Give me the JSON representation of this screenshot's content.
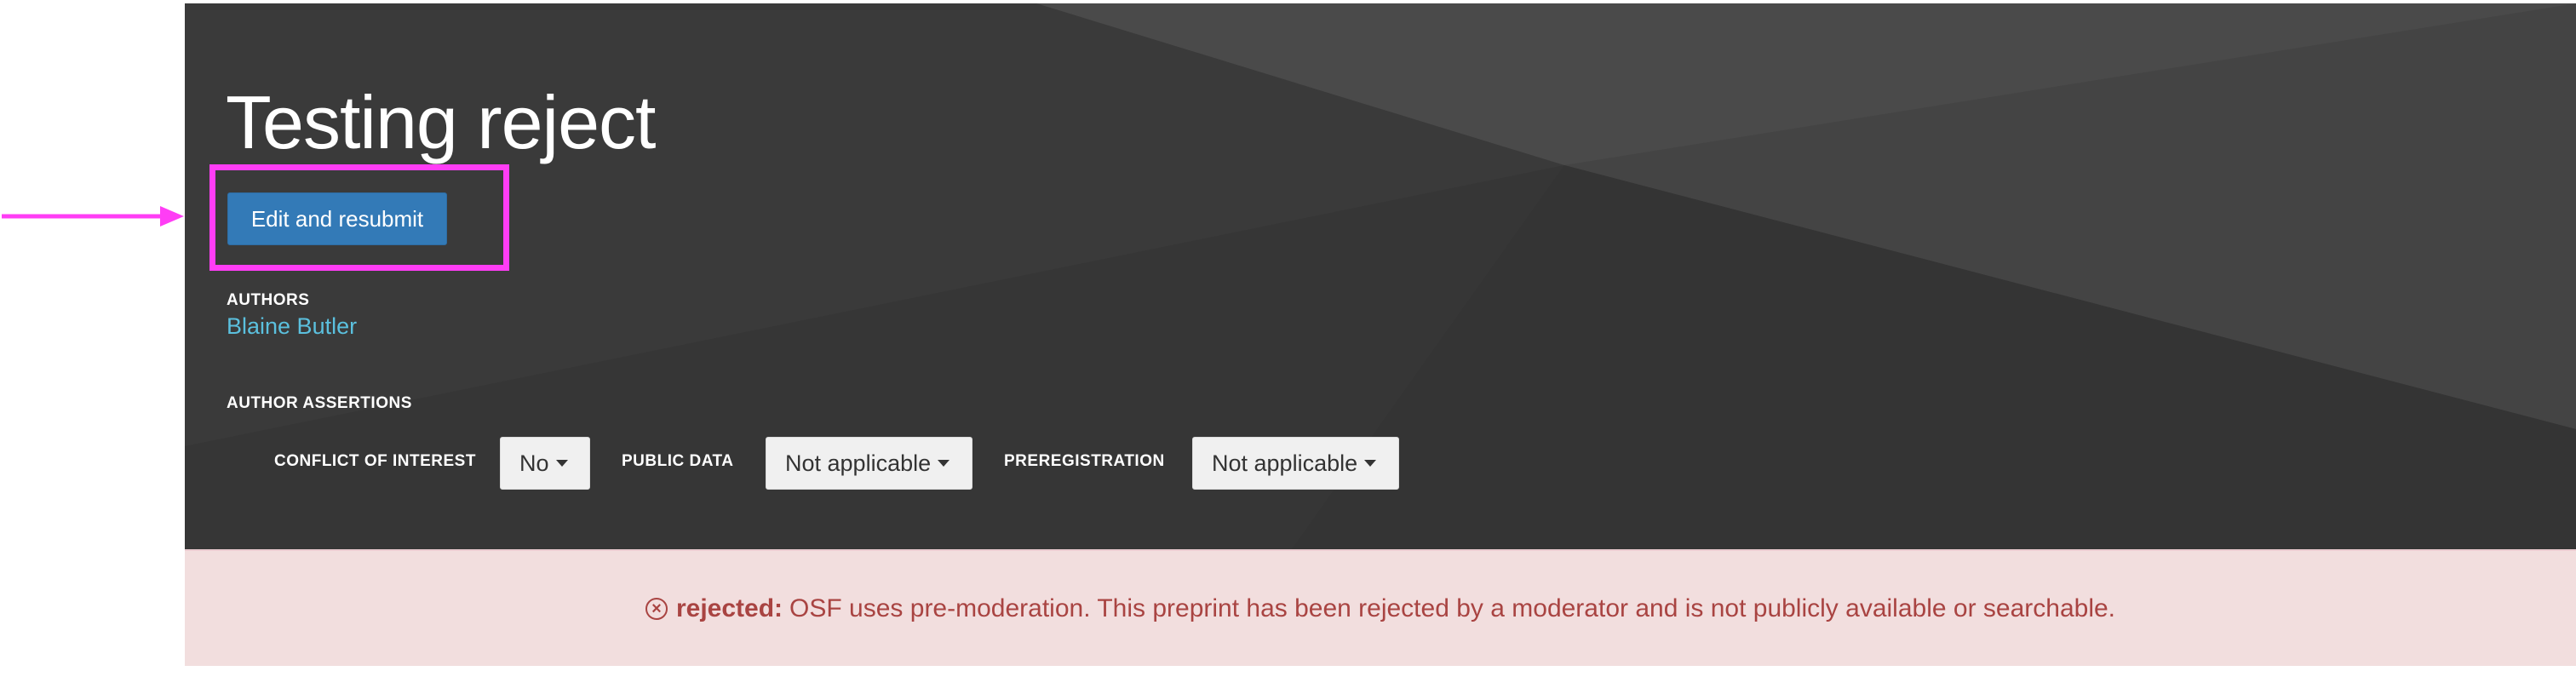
{
  "header": {
    "title": "Testing reject",
    "edit_button_label": "Edit and resubmit",
    "authors_label": "AUTHORS",
    "authors": [
      "Blaine Butler"
    ],
    "assertions_label": "AUTHOR ASSERTIONS",
    "assertions": [
      {
        "label": "CONFLICT OF INTEREST",
        "value": "No"
      },
      {
        "label": "PUBLIC DATA",
        "value": "Not applicable"
      },
      {
        "label": "PREREGISTRATION",
        "value": "Not applicable"
      }
    ]
  },
  "banner": {
    "icon": "x-circle-icon",
    "status": "rejected:",
    "message": "OSF uses pre-moderation. This preprint has been rejected by a moderator and is not publicly available or searchable."
  },
  "annotation": {
    "color": "#ff3df5",
    "target": "edit-and-resubmit-button"
  },
  "colors": {
    "header_bg": "#3a3a3a",
    "primary": "#337ab7",
    "link": "#5bc0de",
    "danger_bg": "#f2dede",
    "danger_text": "#a94442"
  }
}
